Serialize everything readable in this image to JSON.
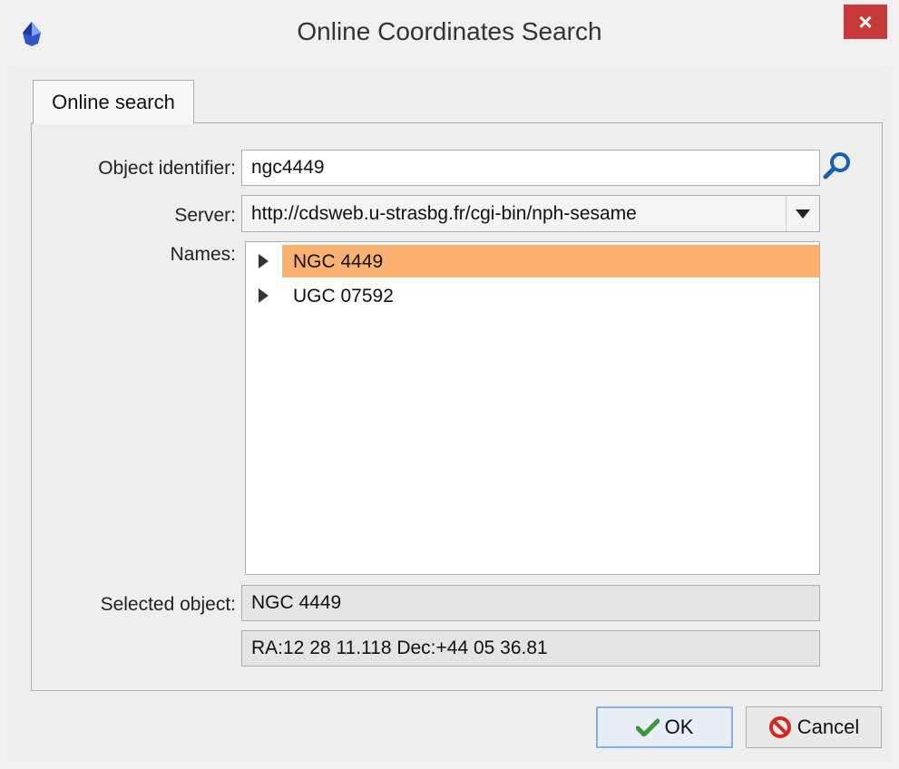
{
  "window": {
    "title": "Online Coordinates Search",
    "close_label": "×"
  },
  "tabs": [
    {
      "label": "Online search"
    }
  ],
  "form": {
    "object_identifier_label": "Object identifier:",
    "object_identifier_value": "ngc4449",
    "server_label": "Server:",
    "server_value": "http://cdsweb.u-strasbg.fr/cgi-bin/nph-sesame",
    "names_label": "Names:",
    "names": [
      {
        "label": "NGC 4449",
        "selected": true
      },
      {
        "label": "UGC 07592",
        "selected": false
      }
    ],
    "selected_object_label": "Selected object:",
    "selected_object_value": "NGC 4449",
    "coordinates_value": "RA:12 28 11.118  Dec:+44 05 36.81"
  },
  "buttons": {
    "ok_label": "OK",
    "cancel_label": "Cancel"
  },
  "colors": {
    "selection": "#fbb270",
    "close": "#c8393a",
    "default_button_border": "#7eb4ea",
    "icon_blue": "#1a5fb4"
  },
  "icons": [
    "app-icon",
    "close-icon",
    "search-icon",
    "chevron-down-icon",
    "expander-icon",
    "checkmark-icon",
    "cancel-icon"
  ]
}
